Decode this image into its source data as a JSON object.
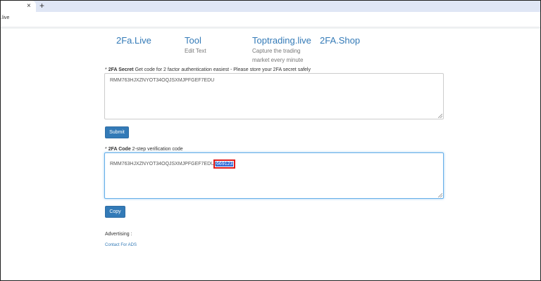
{
  "browser": {
    "new_tab_symbol": "+",
    "close_symbol": "×",
    "address": ".live"
  },
  "nav": [
    {
      "label": "2Fa.Live",
      "sub": []
    },
    {
      "label": "Tool",
      "sub": [
        "Edit Text"
      ]
    },
    {
      "label": "Toptrading.live",
      "sub": [
        "Capture the trading",
        "market every minute"
      ]
    },
    {
      "label": "2FA.Shop",
      "sub": []
    }
  ],
  "secret": {
    "required": "*",
    "title": "2FA Secret",
    "hint": "Get code for 2 factor authentication easiest - Please store your 2FA secret safely",
    "value": "RMM763HJXZNYOT34OQJSXMJPFGEF7EDU"
  },
  "submit_label": "Submit",
  "code": {
    "required": "*",
    "title": "2FA Code",
    "hint": "2-step verification code",
    "prefix": "RMM763HJXZNYOT34OQJSXMJPFGEF7EDU",
    "separator": "|",
    "otp": "669123"
  },
  "copy_label": "Copy",
  "ads": {
    "label": "Advertising :",
    "link": "Contact For ADS"
  }
}
